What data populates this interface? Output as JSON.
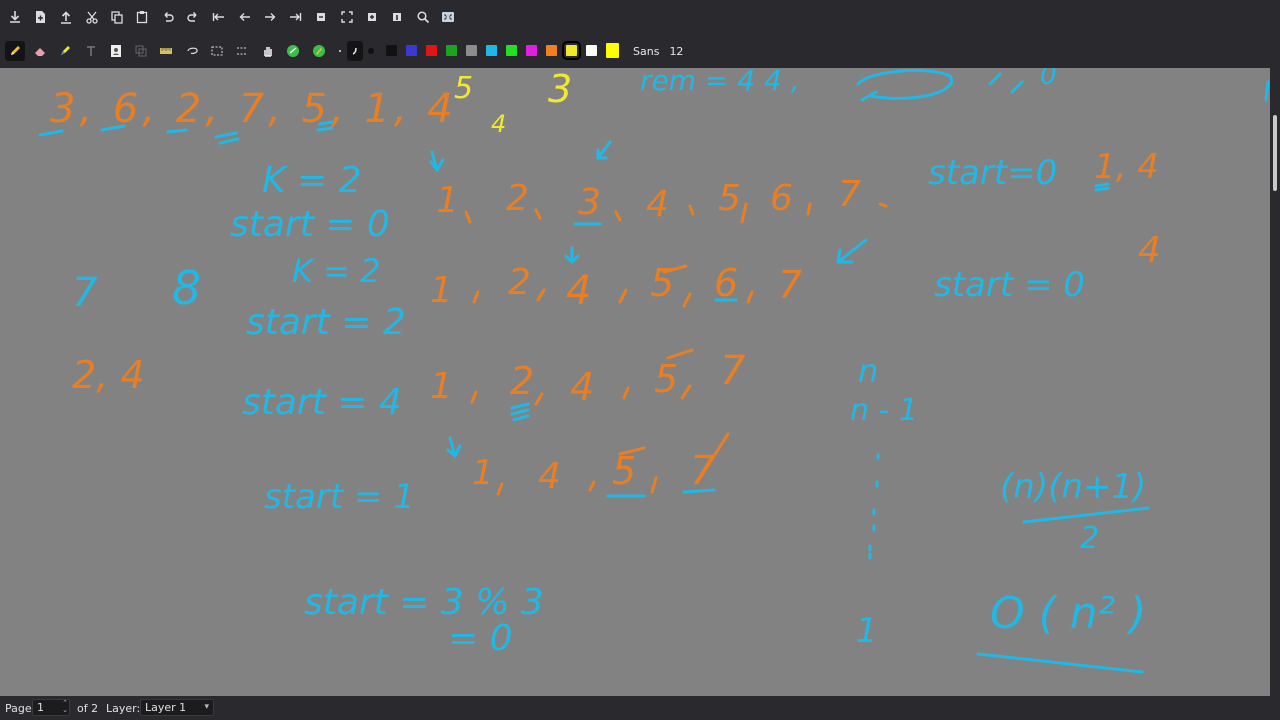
{
  "toolbar_top": {
    "icons": [
      "save-icon",
      "new-page-icon",
      "export-icon",
      "cut-icon",
      "copy-icon",
      "paste-icon",
      "undo-icon",
      "redo-icon",
      "goto-first-page-icon",
      "previous-page-icon",
      "next-page-icon",
      "goto-last-page-icon",
      "insert-page-icon",
      "fit-page-icon",
      "fit-width-icon",
      "page-layout-icon",
      "zoom-icon",
      "fullscreen-icon"
    ]
  },
  "toolbar_tools": {
    "icons": [
      "pen-icon",
      "eraser-icon",
      "highlighter-icon",
      "text-icon",
      "image-icon",
      "select-object-icon",
      "ruler-icon",
      "select-lasso-icon",
      "select-rect-icon",
      "select-region-icon",
      "hand-icon",
      "shape-recognizer-icon",
      "default-tool-icon",
      "fine-thickness-icon",
      "medium-thickness-icon"
    ],
    "colors": [
      "#111111",
      "#3a3ad0",
      "#e01515",
      "#1fa31f",
      "#8d8d8d",
      "#21b8e5",
      "#22e022",
      "#e020e0",
      "#f08020",
      "#f2e830",
      "#ffffff",
      "#ffff00"
    ],
    "selected_color": "#f2e830",
    "font_name": "Sans",
    "font_size": "12"
  },
  "canvas": {
    "page_color": "#828282",
    "ink_colors": {
      "orange": "#e87f24",
      "blue": "#21b8e5",
      "yellow": "#f2e830"
    },
    "notes": {
      "array_top": "3, 6, 2, 7, 5, 1, 4",
      "top_rem": "rem = 4  4 ,",
      "top_zero": "0",
      "top_y1": "5",
      "top_y2": "3",
      "top_y3": "4",
      "k_eq_2": "K = 2",
      "start_0": "start = 0",
      "row1_values": [
        "1",
        "2",
        "3",
        "4",
        "5",
        "6",
        "7"
      ],
      "start_0_right": "start=0",
      "one_four": "1, 4",
      "four_a": "4",
      "seven": "7",
      "eight": "8",
      "k_eq_2b": "K = 2",
      "start_2": "start = 2",
      "row2_values": [
        "1",
        "2",
        "4",
        "5",
        "6",
        "7"
      ],
      "start_0_right2": "start = 0",
      "two_four": "2, 4",
      "start_4": "start = 4",
      "row3_values": [
        "1",
        "2",
        "4",
        "5",
        "7"
      ],
      "n": "n",
      "n_minus_1": "n - 1",
      "start_1": "start = 1",
      "row4_values": [
        "1",
        "4",
        "5",
        "7"
      ],
      "sum_formula_num": "(n)(n+1)",
      "sum_formula_den": "2",
      "start_3mod3": "start = 3 % 3",
      "eq_zero": "= 0",
      "one": "1",
      "big_o": "O ( n² )"
    }
  },
  "statusbar": {
    "page_label": "Page",
    "page_value": "1",
    "of_pages": "of 2",
    "layer_label": "Layer:",
    "layer_value": "Layer 1"
  }
}
